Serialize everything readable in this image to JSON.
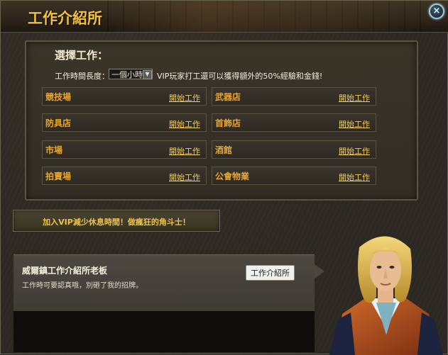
{
  "window": {
    "title": "工作介紹所",
    "close_glyph": "×"
  },
  "panel": {
    "title": "選擇工作：",
    "time_label": "工作時間長度：",
    "time_value": "一個小時",
    "vip_note": "VIP玩家打工還可以獲得額外的50%經驗和金錢!",
    "jobs": [
      {
        "name": "競技場",
        "action": "開始工作"
      },
      {
        "name": "武器店",
        "action": "開始工作"
      },
      {
        "name": "防具店",
        "action": "開始工作"
      },
      {
        "name": "首飾店",
        "action": "開始工作"
      },
      {
        "name": "市場",
        "action": "開始工作"
      },
      {
        "name": "酒館",
        "action": "開始工作"
      },
      {
        "name": "拍賣場",
        "action": "開始工作"
      },
      {
        "name": "公會物業",
        "action": "開始工作"
      }
    ]
  },
  "vip_banner": {
    "text": "加入VIP減少休息時間！做瘋狂的角斗士！"
  },
  "npc": {
    "name": "威爾鎮工作介紹所老板",
    "line": "工作時可要認真哦，別砸了我的招牌。",
    "tag": "工作介紹所"
  },
  "colors": {
    "title": "#f3c23a",
    "job_name": "#eba62c",
    "job_link": "#f1cc5a"
  }
}
